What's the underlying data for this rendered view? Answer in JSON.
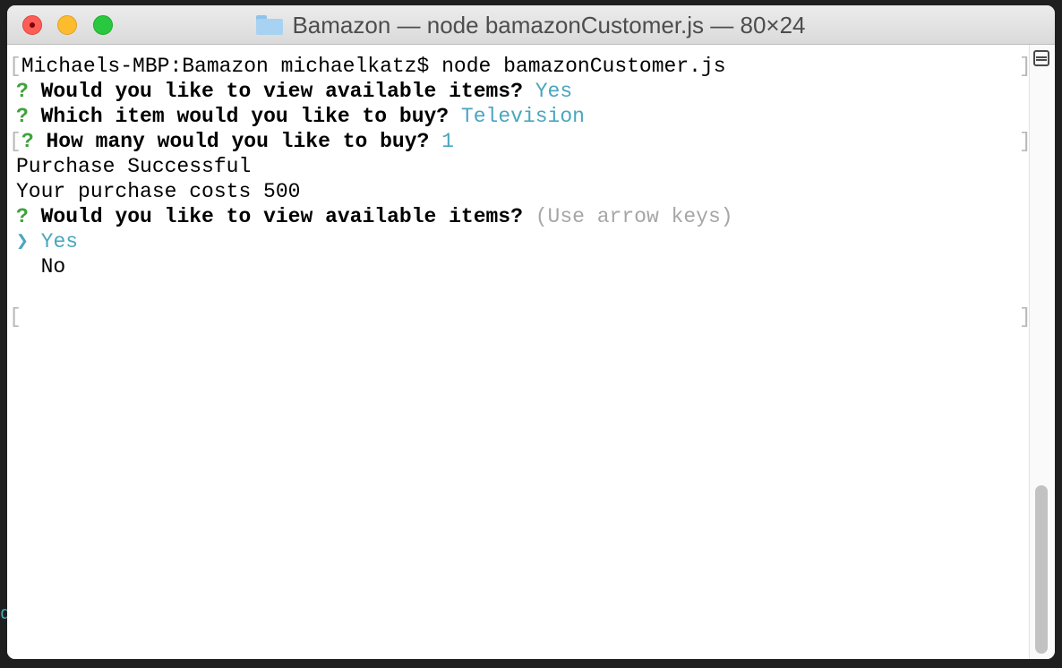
{
  "window": {
    "title": "Bamazon — node bamazonCustomer.js — 80×24"
  },
  "terminal": {
    "prompt_line": "Michaels-MBP:Bamazon michaelkatz$ node bamazonCustomer.js",
    "q1_mark": "?",
    "q1_text": "Would you like to view available items?",
    "q1_answer": "Yes",
    "q2_mark": "?",
    "q2_text": "Which item would you like to buy?",
    "q2_answer": "Television",
    "q3_mark": "?",
    "q3_text": "How many would you like to buy?",
    "q3_answer": "1",
    "result_line": "Purchase Successful",
    "cost_line": "Your purchase costs 500",
    "q4_mark": "?",
    "q4_text": "Would you like to view available items?",
    "q4_hint": "(Use arrow keys)",
    "option_pointer": "❯",
    "option_selected": "Yes",
    "option_other": "No",
    "mark_left": "[",
    "mark_right": "]",
    "side_glyph": "q"
  },
  "colors": {
    "answer": "#4aa6be",
    "question_mark": "#3ea33b",
    "hint": "#a6a6a6",
    "close": "#fc5e57",
    "minimize": "#fdbc2e",
    "maximize": "#29c840"
  },
  "icons": [
    "close-icon",
    "minimize-icon",
    "maximize-icon",
    "folder-icon",
    "split-pane-icon"
  ]
}
